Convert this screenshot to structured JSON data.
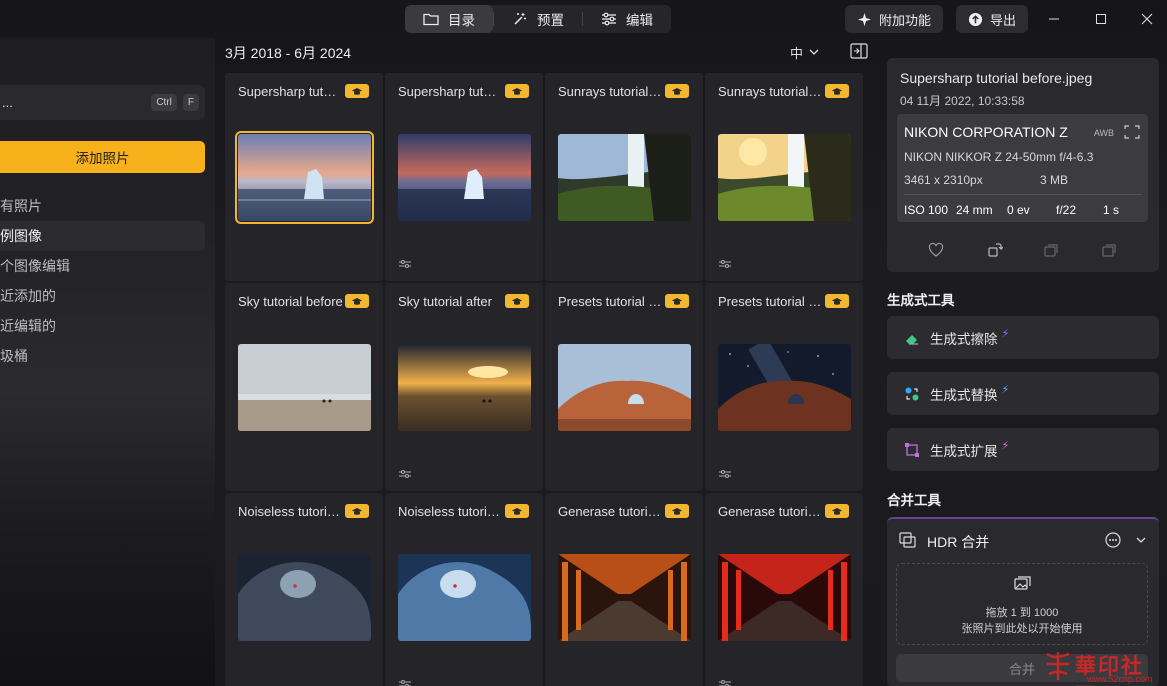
{
  "tabs": [
    {
      "label": "目录",
      "icon": "folder-icon",
      "active": true
    },
    {
      "label": "预置",
      "icon": "magic-wand-icon",
      "active": false
    },
    {
      "label": "编辑",
      "icon": "sliders-icon",
      "active": false
    }
  ],
  "topbar": {
    "addons_label": "附加功能",
    "export_label": "导出"
  },
  "sidebar": {
    "search_placeholder": "...",
    "shortcut_ctrl": "Ctrl",
    "shortcut_f": "F",
    "add_photos_label": "添加照片",
    "items": [
      {
        "label": "有照片",
        "active": false
      },
      {
        "label": "例图像",
        "active": true
      },
      {
        "label": "个图像编辑",
        "active": false
      },
      {
        "label": "近添加的",
        "active": false
      },
      {
        "label": "近编辑的",
        "active": false
      },
      {
        "label": "圾桶",
        "active": false
      }
    ]
  },
  "gallery": {
    "date_range": "3月 2018 - 6月 2024",
    "size_label": "中",
    "photos": [
      {
        "title": "Supersharp tutorial before.jpeg",
        "scene": "iceberg",
        "selected": true,
        "edited": false
      },
      {
        "title": "Supersharp tutorial after",
        "scene": "iceberg-dark",
        "selected": false,
        "edited": true
      },
      {
        "title": "Sunrays tutorial before",
        "scene": "waterfall",
        "selected": false,
        "edited": false
      },
      {
        "title": "Sunrays tutorial after",
        "scene": "waterfall-sun",
        "selected": false,
        "edited": true
      },
      {
        "title": "Sky tutorial before",
        "scene": "beach-grey",
        "selected": false,
        "edited": false
      },
      {
        "title": "Sky tutorial after",
        "scene": "beach-sunset",
        "selected": false,
        "edited": true
      },
      {
        "title": "Presets tutorial before",
        "scene": "arch-day",
        "selected": false,
        "edited": false
      },
      {
        "title": "Presets tutorial after",
        "scene": "arch-night",
        "selected": false,
        "edited": true
      },
      {
        "title": "Noiseless tutorial before",
        "scene": "cave",
        "selected": false,
        "edited": false
      },
      {
        "title": "Noiseless tutorial after",
        "scene": "cave-blue",
        "selected": false,
        "edited": true
      },
      {
        "title": "Generase tutorial before",
        "scene": "torii-orange",
        "selected": false,
        "edited": false
      },
      {
        "title": "Generase tutorial after",
        "scene": "torii-red",
        "selected": false,
        "edited": true
      }
    ]
  },
  "info": {
    "filename": "Supersharp tutorial before.jpeg",
    "datetime": "04 11月 2022, 10:33:58",
    "camera": "NIKON CORPORATION Z",
    "awb": "AWB",
    "lens": "NIKON NIKKOR Z 24-50mm f/4-6.3",
    "dimensions": "3461 x 2310px",
    "filesize": "3 MB",
    "iso": "ISO 100",
    "focal": "24 mm",
    "ev": "0 ev",
    "aperture": "f/22",
    "shutter": "1 s"
  },
  "gen_tools": {
    "title": "生成式工具",
    "items": [
      {
        "label": "生成式擦除",
        "icon": "eraser-icon"
      },
      {
        "label": "生成式替换",
        "icon": "replace-icon"
      },
      {
        "label": "生成式扩展",
        "icon": "expand-icon"
      }
    ]
  },
  "merge_tools": {
    "title": "合并工具",
    "hdr_title": "HDR 合并",
    "drop_line1": "拖放 1 到 1000",
    "drop_line2": "张照片到此处以开始使用",
    "merge_label": "合并"
  },
  "watermark": {
    "main": "華印社區",
    "sub": "www.52cnp.com"
  },
  "colors": {
    "accent": "#f7b21b",
    "panel": "#2a2a2e",
    "ai_purple": "#9a6bff"
  }
}
